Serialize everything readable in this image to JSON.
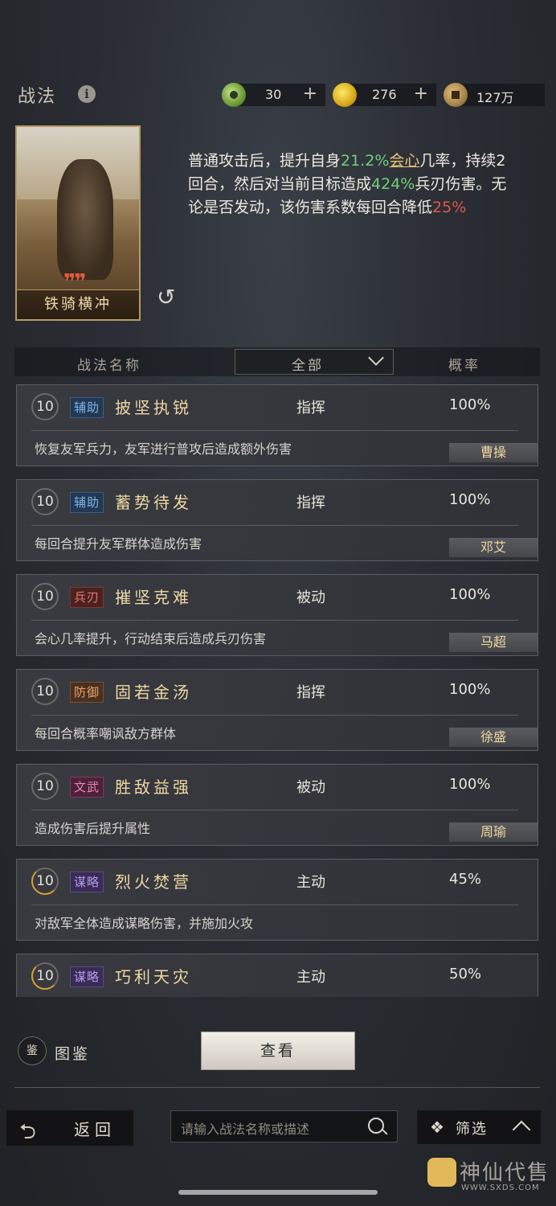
{
  "header": {
    "title": "战法",
    "resources": [
      {
        "value": "30",
        "plus": "+"
      },
      {
        "value": "276",
        "plus": "+"
      },
      {
        "value": "127万"
      }
    ]
  },
  "skill": {
    "card_name": "铁骑横冲",
    "card_marks": "❞❞",
    "desc": {
      "p1": "普通攻击后，提升自身",
      "v1": "21.2%",
      "k1": "会心",
      "p2": "几率，持续2回合，然后对当前目标造成",
      "v2": "424%",
      "p3": "兵刃伤害。无论是否发动，该伤害系数每回合降低",
      "v3": "25%"
    }
  },
  "table_header": {
    "name_col": "战法名称",
    "filter": "全部",
    "rate_col": "概率"
  },
  "rows": [
    {
      "level": "10",
      "tag": "辅助",
      "name": "披坚执锐",
      "type": "指挥",
      "rate": "100%",
      "desc": "恢复友军兵力，友军进行普攻后造成额外伤害",
      "general": "曹操"
    },
    {
      "level": "10",
      "tag": "辅助",
      "name": "蓄势待发",
      "type": "指挥",
      "rate": "100%",
      "desc": "每回合提升友军群体造成伤害",
      "general": "邓艾"
    },
    {
      "level": "10",
      "tag": "兵刃",
      "name": "摧坚克难",
      "type": "被动",
      "rate": "100%",
      "desc": "会心几率提升，行动结束后造成兵刃伤害",
      "general": "马超"
    },
    {
      "level": "10",
      "tag": "防御",
      "name": "固若金汤",
      "type": "指挥",
      "rate": "100%",
      "desc": "每回合概率嘲讽敌方群体",
      "general": "徐盛"
    },
    {
      "level": "10",
      "tag": "文武",
      "name": "胜敌益强",
      "type": "被动",
      "rate": "100%",
      "desc": "造成伤害后提升属性",
      "general": "周瑜"
    },
    {
      "level": "10",
      "tag": "谋略",
      "name": "烈火焚营",
      "type": "主动",
      "rate": "45%",
      "desc": "对敌军全体造成谋略伤害，并施加火攻",
      "general": ""
    },
    {
      "level": "10",
      "tag": "谋略",
      "name": "巧利天灾",
      "type": "主动",
      "rate": "50%",
      "desc": "",
      "general": ""
    }
  ],
  "bottom": {
    "atlas_icon": "鉴",
    "atlas_label": "图鉴",
    "view_button": "查看",
    "back_label": "返回",
    "search_placeholder": "请输入战法名称或描述",
    "filter_label": "筛选"
  },
  "watermark": {
    "text": "神仙代售",
    "url": "WWW.SXDS.COM"
  },
  "colors": {
    "highlight_green": "#6fd07a",
    "highlight_red": "#e0574a",
    "keyword_gold": "#e9c274"
  }
}
